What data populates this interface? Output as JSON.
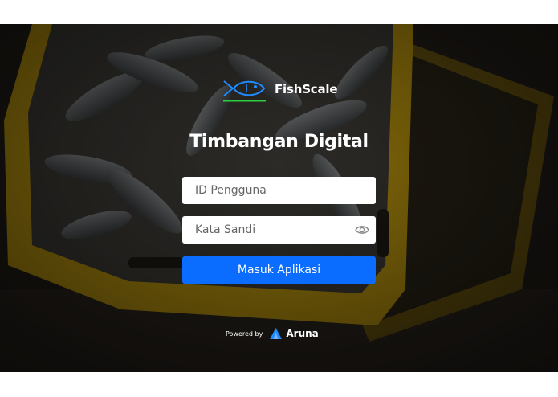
{
  "brand": {
    "name": "FishScale",
    "logo_icon": "fish-icon"
  },
  "login": {
    "title": "Timbangan Digital",
    "user_placeholder": "ID Pengguna",
    "password_placeholder": "Kata Sandi",
    "submit_label": "Masuk Aplikasi",
    "password_toggle_icon": "eye-icon"
  },
  "footer": {
    "powered_label": "Powered by",
    "partner_name": "Aruna",
    "partner_icon": "aruna-logo-icon"
  },
  "colors": {
    "primary_button": "#0a6dff",
    "logo_accent_blue": "#1f8bff",
    "logo_accent_green": "#2ecc40",
    "crate_yellow": "#c9a21a"
  }
}
